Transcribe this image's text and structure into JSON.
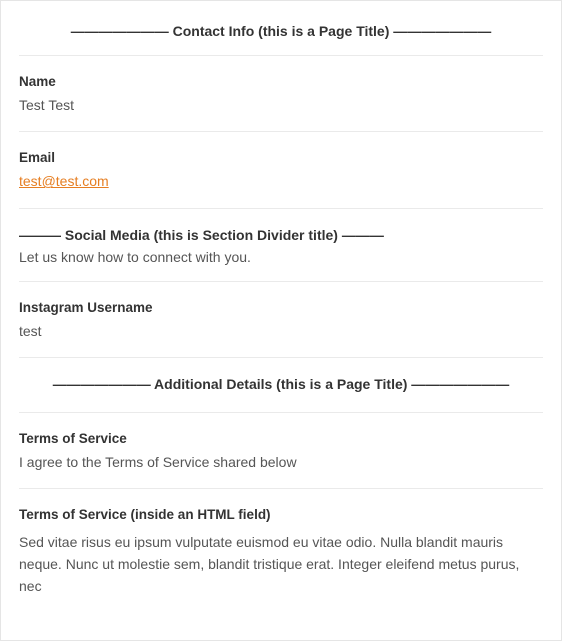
{
  "page_title_1": "——————— Contact Info (this is a Page Title) ———————",
  "name": {
    "label": "Name",
    "value": "Test Test"
  },
  "email": {
    "label": "Email",
    "value": "test@test.com"
  },
  "social_divider": {
    "title": "——— Social Media (this is Section Divider title) ———",
    "description": "Let us know how to connect with you."
  },
  "instagram": {
    "label": "Instagram Username",
    "value": "test"
  },
  "page_title_2": "——————— Additional Details (this is a Page Title) ———————",
  "tos": {
    "label": "Terms of Service",
    "value": "I agree to the Terms of Service shared below"
  },
  "tos_html": {
    "label": "Terms of Service (inside an HTML field)",
    "body": "Sed vitae risus eu ipsum vulputate euismod eu vitae odio. Nulla blandit mauris neque. Nunc ut molestie sem, blandit tristique erat. Integer eleifend metus purus, nec"
  }
}
